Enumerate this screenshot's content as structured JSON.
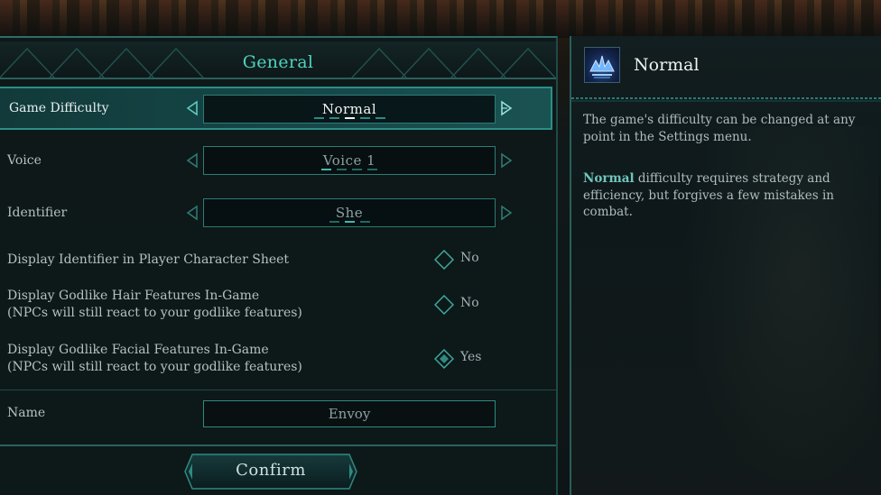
{
  "panel": {
    "title": "General",
    "rows": {
      "difficulty": {
        "label": "Game Difficulty",
        "value": "Normal",
        "options_count": 5,
        "selected_index": 2
      },
      "voice": {
        "label": "Voice",
        "value": "Voice 1",
        "options_count": 4,
        "selected_index": 0
      },
      "identifier": {
        "label": "Identifier",
        "value": "She",
        "options_count": 3,
        "selected_index": 1
      },
      "display_identifier": {
        "label": "Display Identifier in Player Character Sheet",
        "value": "No",
        "checked": false
      },
      "hair_features": {
        "label_line1": "Display Godlike Hair Features In-Game",
        "label_line2": "(NPCs will still react to your godlike features)",
        "value": "No",
        "checked": false
      },
      "facial_features": {
        "label_line1": "Display Godlike Facial Features In-Game",
        "label_line2": "(NPCs will still react to your godlike features)",
        "value": "Yes",
        "checked": true
      },
      "name": {
        "label": "Name",
        "value": "Envoy"
      }
    },
    "confirm_label": "Confirm"
  },
  "info": {
    "icon": "difficulty-crown-icon",
    "title": "Normal",
    "paragraph1": "The game's difficulty can be changed at any point in the Settings menu.",
    "paragraph2_bold": "Normal",
    "paragraph2_rest": " difficulty requires strategy and efficiency, but forgives a few mistakes in combat."
  },
  "colors": {
    "accent": "#4fd3bd",
    "border": "#2b8f86",
    "panel_bg": "#0e181a",
    "highlight_text": "#6fc6bd"
  }
}
